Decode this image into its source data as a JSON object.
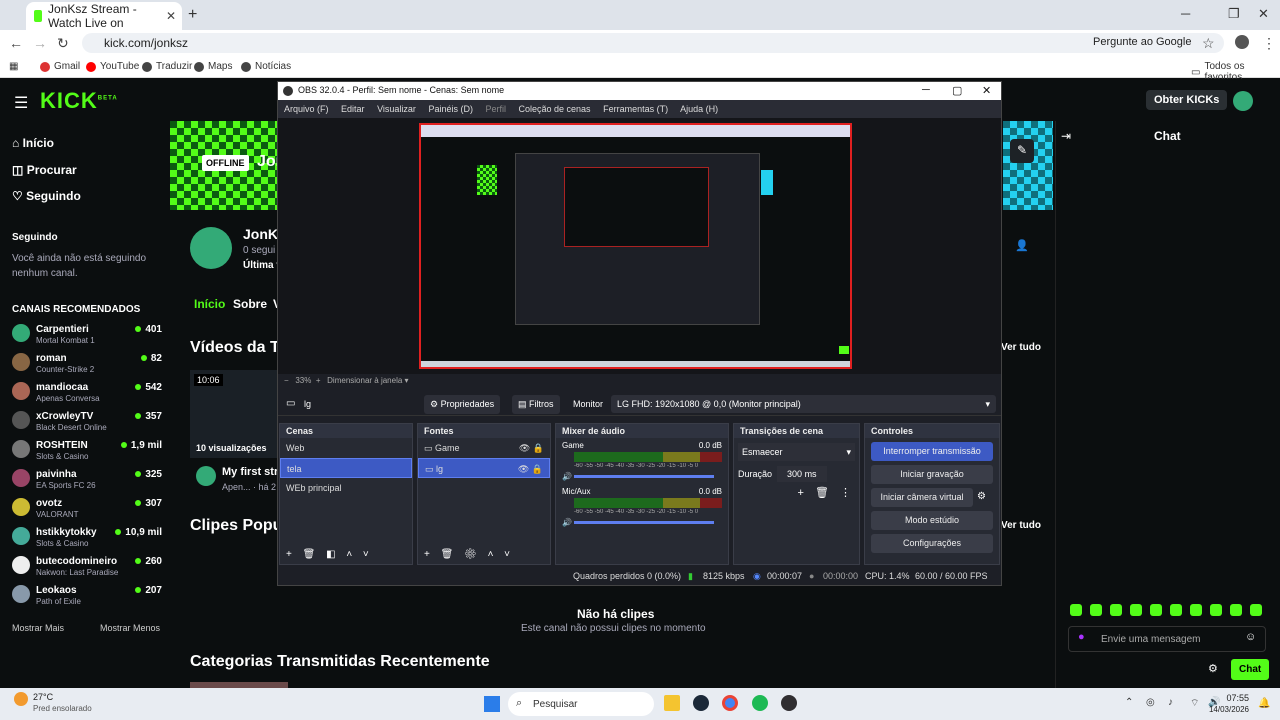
{
  "browser": {
    "tab_title": "JonKsz Stream - Watch Live on",
    "new_tab": "+",
    "url": "kick.com/jonksz",
    "ask_google": "Pergunte ao Google",
    "bookmarks": [
      "Gmail",
      "YouTube",
      "Traduzir",
      "Maps",
      "Notícias"
    ],
    "all_favorites": "Todos os favoritos"
  },
  "kick": {
    "logo": "KICK",
    "logo_beta": "BETA",
    "menu": [
      "Início",
      "Procurar",
      "Seguindo"
    ],
    "following_heading": "Seguindo",
    "following_empty": "Você ainda não está seguindo nenhum canal.",
    "recommended_heading": "CANAIS RECOMENDADOS",
    "channels": [
      {
        "name": "Carpentieri",
        "game": "Mortal Kombat 1",
        "viewers": "401"
      },
      {
        "name": "roman",
        "game": "Counter-Strike 2",
        "viewers": "82"
      },
      {
        "name": "mandiocaa",
        "game": "Apenas Conversa",
        "viewers": "542"
      },
      {
        "name": "xCrowleyTV",
        "game": "Black Desert Online",
        "viewers": "357"
      },
      {
        "name": "ROSHTEIN",
        "game": "Slots & Casino",
        "viewers": "1,9 mil"
      },
      {
        "name": "paivinha",
        "game": "EA Sports FC 26",
        "viewers": "325"
      },
      {
        "name": "ovotz",
        "game": "VALORANT",
        "viewers": "307"
      },
      {
        "name": "hstikkytokky",
        "game": "Slots & Casino",
        "viewers": "10,9 mil"
      },
      {
        "name": "butecodomineiro",
        "game": "Nakwon: Last Paradise",
        "viewers": "260"
      },
      {
        "name": "Leokaos",
        "game": "Path of Exile",
        "viewers": "207"
      }
    ],
    "show_more": "Mostrar Mais",
    "show_less": "Mostrar Menos",
    "offline": "OFFLINE",
    "banner_name": "Jon",
    "channel_name": "JonK",
    "followers_partial": "0 segui",
    "last_partial": "Última v",
    "tabs": [
      "Início",
      "Sobre",
      "V"
    ],
    "videos_heading": "Vídeos da T",
    "video_duration": "10:06",
    "video_views": "10 visualizações",
    "video_title": "My first str",
    "video_sub": "Apen... · há 2",
    "clips_heading": "Clipes Popu",
    "no_clips": "Não há clipes",
    "no_clips_sub": "Este canal não possui clipes no momento",
    "categories_heading": "Categorias Transmitidas Recentemente",
    "see_all": "Ver tudo",
    "chat_title": "Chat",
    "get_kicks": "Obter KICKs",
    "message_placeholder": "Envie uma mensagem",
    "chat_button": "Chat"
  },
  "obs": {
    "title": "OBS 32.0.4 - Perfil: Sem nome - Cenas: Sem nome",
    "menu": [
      "Arquivo (F)",
      "Editar",
      "Visualizar",
      "Painéis (D)",
      "Perfil",
      "Coleção de cenas",
      "Ferramentas (T)",
      "Ajuda (H)"
    ],
    "zoom": "33%",
    "zoom_mode": "Dimensionar à janela",
    "source_name": "lg",
    "properties": "Propriedades",
    "filters": "Filtros",
    "monitor_label": "Monitor",
    "monitor_value": "LG FHD: 1920x1080 @ 0,0 (Monitor principal)",
    "scenes_title": "Cenas",
    "scenes": [
      "Web",
      "tela",
      "WEb principal"
    ],
    "sources_title": "Fontes",
    "sources": [
      "Game",
      "lg"
    ],
    "mixer_title": "Mixer de áudio",
    "mixer": [
      {
        "name": "Game",
        "db": "0.0 dB"
      },
      {
        "name": "Mic/Aux",
        "db": "0.0 dB"
      }
    ],
    "meter_ticks": "-60 -55 -50 -45 -40 -35 -30 -25 -20 -15 -10 -5 0",
    "transitions_title": "Transições de cena",
    "transition": "Esmaecer",
    "duration_label": "Duração",
    "duration_value": "300 ms",
    "controls_title": "Controles",
    "controls": [
      "Interromper transmissão",
      "Iniciar gravação",
      "Iniciar câmera virtual",
      "Modo estúdio",
      "Configurações"
    ],
    "status": {
      "dropped": "Quadros perdidos 0 (0.0%)",
      "bitrate": "8125 kbps",
      "stream_time": "00:00:07",
      "rec_time": "00:00:00",
      "cpu": "CPU: 1.4%",
      "fps": "60.00 / 60.00 FPS"
    }
  },
  "taskbar": {
    "weather_temp": "27°C",
    "weather_desc": "Pred ensolarado",
    "search": "Pesquisar",
    "time": "07:55",
    "date": "14/03/2026"
  }
}
